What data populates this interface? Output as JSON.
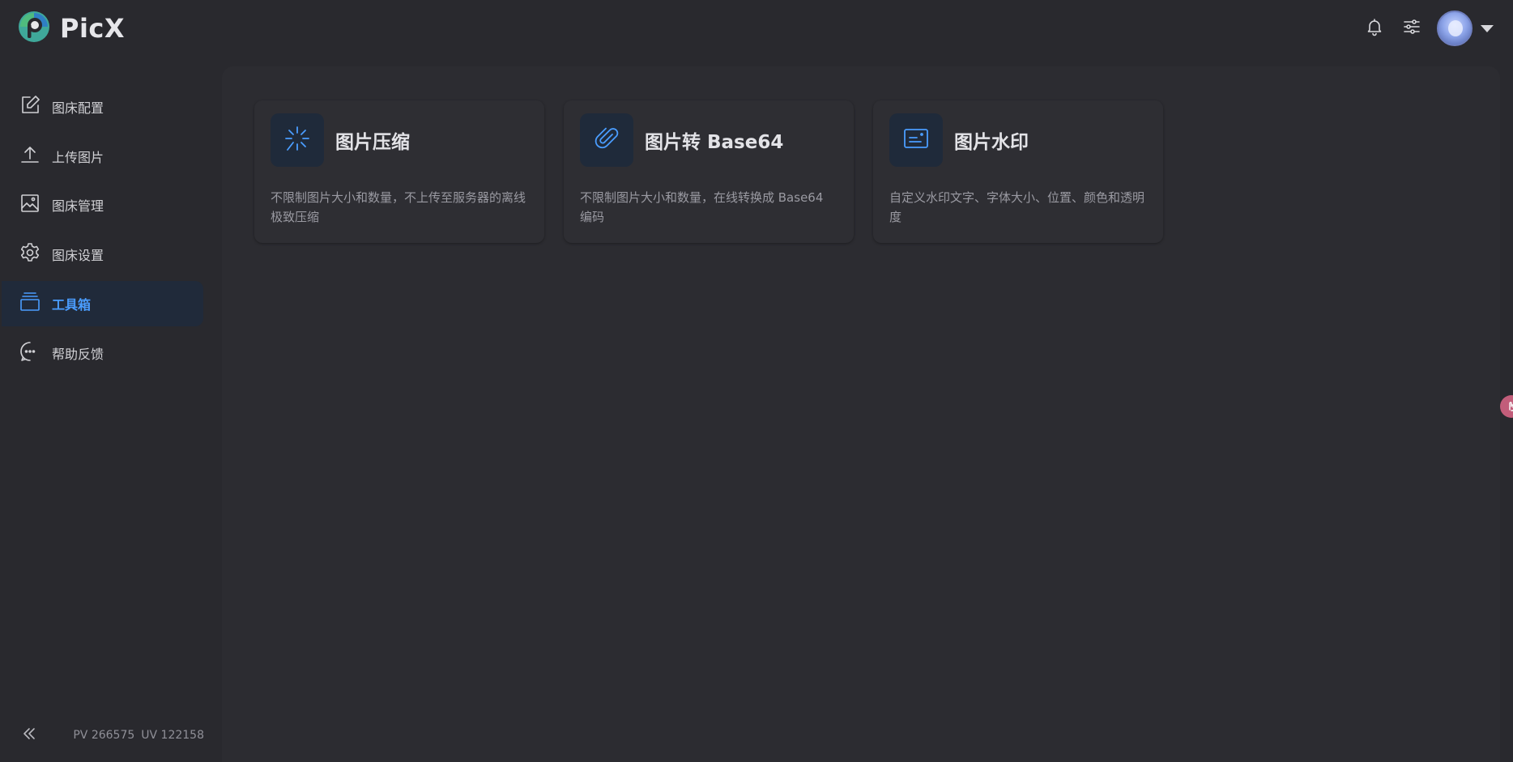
{
  "brand": {
    "name": "PicX",
    "logo_icon": "picx-logo-icon"
  },
  "header": {
    "icons": [
      "bell-icon",
      "sliders-icon"
    ],
    "avatar": "user-avatar"
  },
  "sidebar": {
    "items": [
      {
        "label": "图床配置",
        "icon": "edit-icon"
      },
      {
        "label": "上传图片",
        "icon": "upload-icon"
      },
      {
        "label": "图床管理",
        "icon": "image-icon"
      },
      {
        "label": "图床设置",
        "icon": "gear-icon"
      },
      {
        "label": "工具箱",
        "icon": "toolbox-icon",
        "active": true
      },
      {
        "label": "帮助反馈",
        "icon": "chat-icon"
      }
    ],
    "footer": {
      "pv": "PV 266575",
      "uv": "UV 122158"
    }
  },
  "tools": [
    {
      "title": "图片压缩",
      "desc": "不限制图片大小和数量，不上传至服务器的离线极致压缩",
      "icon": "compress-sparkle-icon"
    },
    {
      "title": "图片转 Base64",
      "desc": "不限制图片大小和数量，在线转换成 Base64 编码",
      "icon": "paperclip-icon"
    },
    {
      "title": "图片水印",
      "desc": "自定义水印文字、字体大小、位置、颜色和透明度",
      "icon": "watermark-card-icon"
    }
  ],
  "colors": {
    "accent": "#4a9dff",
    "active_bg": "#202a3a",
    "background": "#29292e"
  }
}
